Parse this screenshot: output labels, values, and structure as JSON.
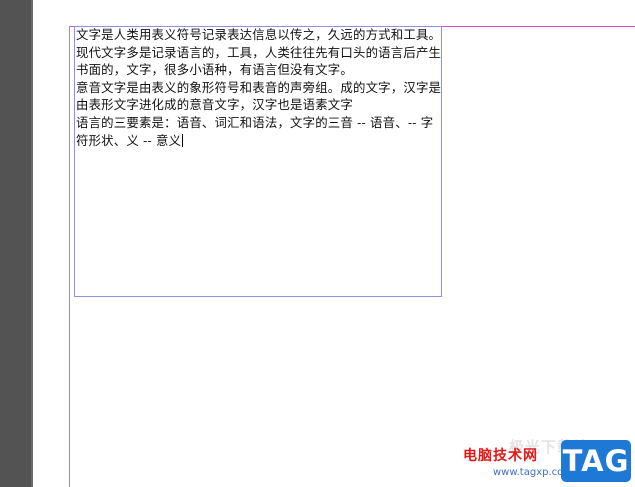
{
  "document": {
    "paragraphs": [
      "文字是人类用表义符号记录表达信息以传之，久远的方式和工具。现代文字多是记录语言的，工具，人类往往先有口头的语言后产生书面的，文字，很多小语种，有语言但没有文字。",
      "意音文字是由表义的象形符号和表音的声旁组。成的文字，汉字是由表形文字进化成的意音文字，汉字也是语素文字",
      "语言的三要素是：语音、词汇和语法，文字的三音 -- 语音、-- 字 符形状、义 -- 意义"
    ]
  },
  "watermark": {
    "main_text": "电脑技术网",
    "faint_text": "极光下载站",
    "url": "www.tagxp.com",
    "badge": "TAG"
  },
  "colors": {
    "left_panel": "#535353",
    "frame_border": "#8f8fe6",
    "margin_guide_top": "#d24fd2",
    "margin_guide_left": "#8c8cf2",
    "watermark_red": "#e01919",
    "badge_blue": "#1e78d6"
  }
}
